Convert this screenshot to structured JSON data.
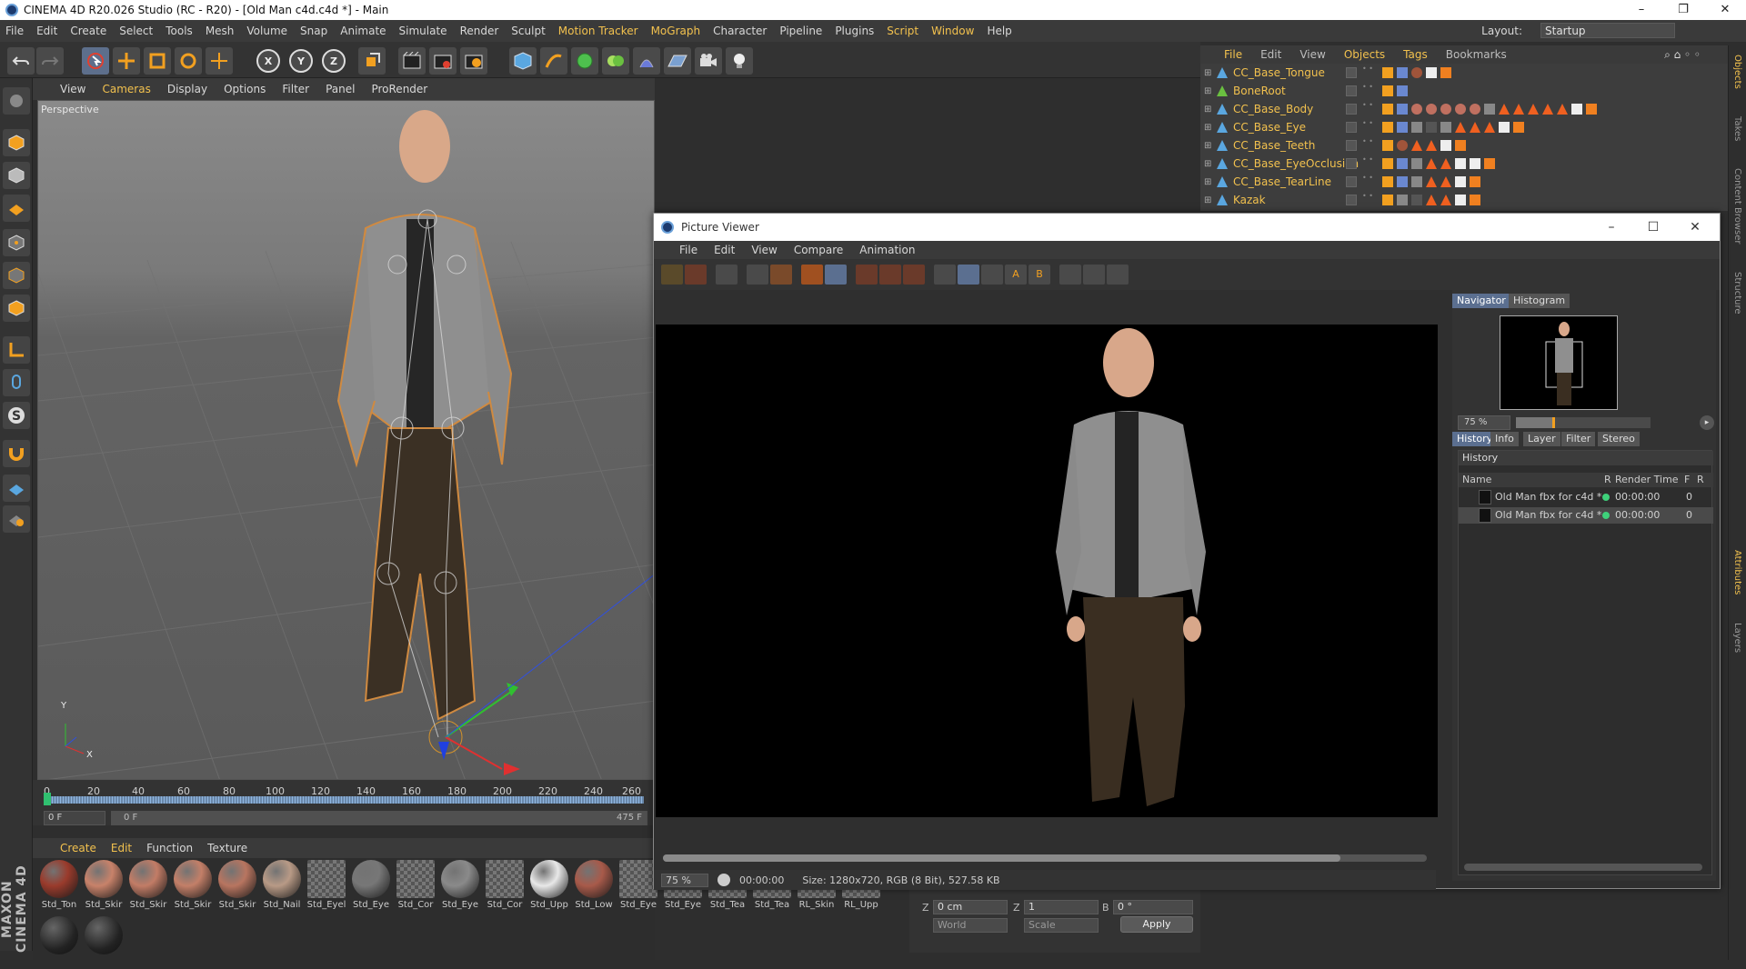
{
  "window": {
    "title": "CINEMA 4D R20.026 Studio (RC - R20) - [Old Man c4d.c4d *] - Main",
    "controls": [
      "–",
      "❐",
      "✕"
    ]
  },
  "menubar": {
    "items": [
      "File",
      "Edit",
      "Create",
      "Select",
      "Tools",
      "Mesh",
      "Volume",
      "Snap",
      "Animate",
      "Simulate",
      "Render",
      "Sculpt",
      "Motion Tracker",
      "MoGraph",
      "Character",
      "Pipeline",
      "Plugins",
      "Script",
      "Window",
      "Help"
    ],
    "layout_label": "Layout:",
    "layout_value": "Startup"
  },
  "toolbar": {
    "axis_x": "X",
    "axis_y": "Y",
    "axis_z": "Z"
  },
  "viewport": {
    "menu": [
      "View",
      "Cameras",
      "Display",
      "Options",
      "Filter",
      "Panel",
      "ProRender"
    ],
    "label": "Perspective",
    "axis_labels": {
      "y": "Y",
      "x": "X"
    }
  },
  "timeline": {
    "ticks": [
      "0",
      "20",
      "40",
      "60",
      "80",
      "100",
      "120",
      "140",
      "160",
      "180",
      "200",
      "220",
      "240",
      "260"
    ],
    "current_frame": "0 F",
    "range_start": "0 F",
    "range_end": "475 F"
  },
  "material_manager": {
    "menu": [
      "Create",
      "Edit",
      "Function",
      "Texture"
    ],
    "materials": [
      {
        "name": "Std_Ton",
        "color": "#9a3b2c"
      },
      {
        "name": "Std_Skir",
        "color": "#c8826a"
      },
      {
        "name": "Std_Skir",
        "color": "#c27c66"
      },
      {
        "name": "Std_Skir",
        "color": "#c37f68"
      },
      {
        "name": "Std_Skir",
        "color": "#b87560"
      },
      {
        "name": "Std_Nail",
        "color": "#b89a86"
      },
      {
        "name": "Std_Eyel",
        "color": "checker"
      },
      {
        "name": "Std_Eye",
        "color": "#777777"
      },
      {
        "name": "Std_Cor",
        "color": "checker"
      },
      {
        "name": "Std_Eye",
        "color": "#8a8a8a"
      },
      {
        "name": "Std_Cor",
        "color": "checker"
      },
      {
        "name": "Std_Upp",
        "color": "#e8e8e8"
      },
      {
        "name": "Std_Low",
        "color": "#a85a4a"
      },
      {
        "name": "Std_Eye",
        "color": "checker"
      },
      {
        "name": "Std_Eye",
        "color": "checker"
      },
      {
        "name": "Std_Tea",
        "color": "checker"
      },
      {
        "name": "Std_Tea",
        "color": "checker"
      },
      {
        "name": "RL_Skin",
        "color": "checker"
      },
      {
        "name": "RL_Upp",
        "color": "checker"
      }
    ],
    "brand": "MAXON CINEMA 4D"
  },
  "object_manager": {
    "menu": [
      "File",
      "Edit",
      "View",
      "Objects",
      "Tags",
      "Bookmarks"
    ],
    "objects": [
      {
        "name": "CC_Base_Tongue"
      },
      {
        "name": "BoneRoot"
      },
      {
        "name": "CC_Base_Body"
      },
      {
        "name": "CC_Base_Eye"
      },
      {
        "name": "CC_Base_Teeth"
      },
      {
        "name": "CC_Base_EyeOcclusion"
      },
      {
        "name": "CC_Base_TearLine"
      },
      {
        "name": "Kazak"
      }
    ]
  },
  "side_tabs": [
    "Objects",
    "Takes",
    "Content Browser",
    "Structure",
    "Attributes",
    "Layers"
  ],
  "attributes": {
    "z_label": "Z",
    "z_pos": "0 cm",
    "z_scale_label": "Z",
    "z_scale": "1",
    "b_label": "B",
    "b_rot": "0 °",
    "coord_system": "World",
    "mode": "Scale",
    "apply": "Apply"
  },
  "picture_viewer": {
    "title": "Picture Viewer",
    "menu": [
      "File",
      "Edit",
      "View",
      "Compare",
      "Animation"
    ],
    "zoom": "75 %",
    "time": "00:00:00",
    "size_info": "Size: 1280x720, RGB (8 Bit), 527.58 KB",
    "top_tabs": [
      "Navigator",
      "Histogram"
    ],
    "nav_zoom": "75 %",
    "bottom_tabs": [
      "History",
      "Info",
      "Layer",
      "Filter",
      "Stereo"
    ],
    "history_header": "History",
    "columns": [
      "Name",
      "R",
      "Render Time",
      "F",
      "R"
    ],
    "rows": [
      {
        "name": "Old Man fbx for c4d *",
        "time": "00:00:00",
        "f": "0"
      },
      {
        "name": "Old Man fbx for c4d *",
        "time": "00:00:00",
        "f": "0"
      }
    ]
  },
  "colors": {
    "accent": "#f2c14e",
    "panel": "#333333",
    "selected_tab": "#5b6f90",
    "status_green": "#3ed07a"
  }
}
